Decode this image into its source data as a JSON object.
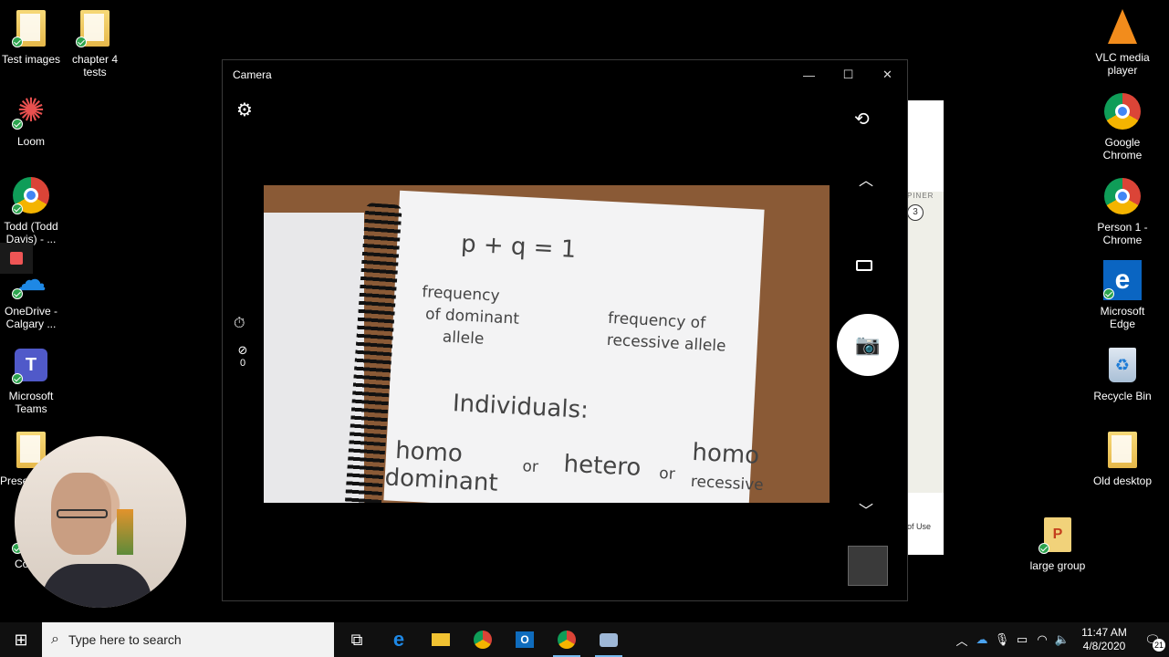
{
  "desktop": {
    "left_icons": [
      {
        "label": "Test images",
        "icon": "folder-icon"
      },
      {
        "label": "chapter 4 tests",
        "icon": "folder-icon"
      },
      {
        "label": "Loom",
        "icon": "loom-icon"
      },
      {
        "label": "Todd (Todd Davis) - ...",
        "icon": "chrome-icon"
      },
      {
        "label": "OneDrive - Calgary ...",
        "icon": "onedrive-icon"
      },
      {
        "label": "Microsoft Teams",
        "icon": "teams-icon"
      },
      {
        "label": "Prese",
        "icon": "folder-icon"
      },
      {
        "label": "Co",
        "icon": "file-icon"
      }
    ],
    "right_icons": [
      {
        "label": "VLC media player",
        "icon": "vlc-icon"
      },
      {
        "label": "Google Chrome",
        "icon": "chrome-icon"
      },
      {
        "label": "Person 1 - Chrome",
        "icon": "chrome-icon"
      },
      {
        "label": "Microsoft Edge",
        "icon": "edge-icon"
      },
      {
        "label": "Recycle Bin",
        "icon": "recycle-bin-icon"
      },
      {
        "label": "Old desktop",
        "icon": "folder-icon"
      },
      {
        "label": "large group",
        "icon": "powerpoint-icon"
      }
    ]
  },
  "background_window": {
    "pin_text": "PINER",
    "pin_number": "3",
    "terms": "of Use"
  },
  "camera": {
    "title": "Camera",
    "counter": "0",
    "notes": {
      "equation": "p + q = 1",
      "label_dominant_1": "frequency",
      "label_dominant_2": "of dominant",
      "label_dominant_3": "allele",
      "label_recessive_1": "frequency of",
      "label_recessive_2": "recessive allele",
      "heading": "Individuals:",
      "w1": "homo",
      "w2": "dominant",
      "w3": "or",
      "w4": "hetero",
      "w5": "or",
      "w6": "homo",
      "w7": "recessive"
    }
  },
  "taskbar": {
    "search_placeholder": "Type here to search",
    "time": "11:47 AM",
    "date": "4/8/2020",
    "notification_count": "21",
    "colors": {
      "bar": "#101010",
      "accent": "#76b9ed"
    }
  }
}
